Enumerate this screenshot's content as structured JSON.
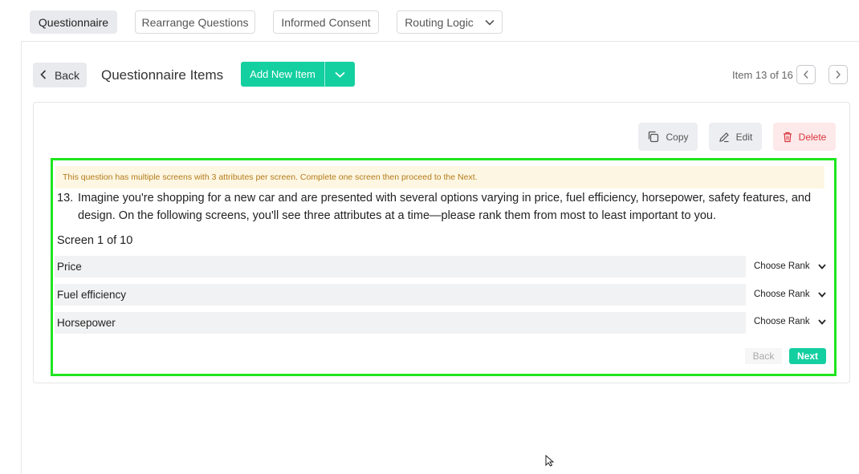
{
  "tabs": [
    {
      "label": "Questionnaire",
      "active": true
    },
    {
      "label": "Rearrange Questions",
      "active": false
    },
    {
      "label": "Informed Consent",
      "active": false
    },
    {
      "label": "Routing Logic",
      "active": false
    }
  ],
  "header": {
    "back_label": "Back",
    "title": "Questionnaire Items",
    "add_item_label": "Add New Item",
    "item_counter": "Item 13 of 16"
  },
  "actions": {
    "copy_label": "Copy",
    "edit_label": "Edit",
    "delete_label": "Delete"
  },
  "question": {
    "notice": "This question has multiple screens with 3 attributes per screen. Complete one screen then proceed to the Next.",
    "number": "13.",
    "text": "Imagine you're shopping for a new car and are presented with several options varying in price, fuel efficiency, horsepower, safety features, and design. On the following screens, you'll see three attributes at a time—please rank them from most to least important to you.",
    "screen_label": "Screen 1 of 10",
    "attributes": [
      {
        "label": "Price",
        "rank_placeholder": "Choose Rank"
      },
      {
        "label": "Fuel efficiency",
        "rank_placeholder": "Choose Rank"
      },
      {
        "label": "Horsepower",
        "rank_placeholder": "Choose Rank"
      }
    ],
    "back_label": "Back",
    "next_label": "Next"
  },
  "colors": {
    "accent": "#14cfa0",
    "delete": "#d9363e",
    "highlight": "#1fe51f",
    "notice_bg": "#fdf6e2"
  }
}
